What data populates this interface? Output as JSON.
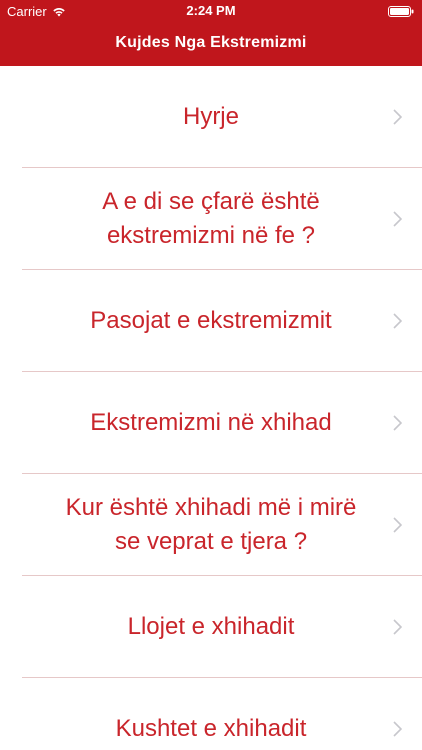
{
  "status_bar": {
    "carrier": "Carrier",
    "time": "2:24 PM",
    "icons": [
      "wifi-icon",
      "battery-icon"
    ]
  },
  "nav_bar": {
    "title": "Kujdes Nga Ekstremizmi"
  },
  "colors": {
    "header_background": "#c0161c",
    "item_text": "#c9252b",
    "chevron": "#c7c7cc",
    "separator": "#e6c8c8"
  },
  "menu": {
    "items": [
      {
        "label": "Hyrje"
      },
      {
        "label": "A e di se çfarë është ekstremizmi në fe ?"
      },
      {
        "label": "Pasojat e ekstremizmit"
      },
      {
        "label": "Ekstremizmi në xhihad"
      },
      {
        "label": "Kur është xhihadi më i mirë se veprat e tjera ?"
      },
      {
        "label": "Llojet e xhihadit"
      },
      {
        "label": "Kushtet e xhihadit"
      }
    ]
  }
}
